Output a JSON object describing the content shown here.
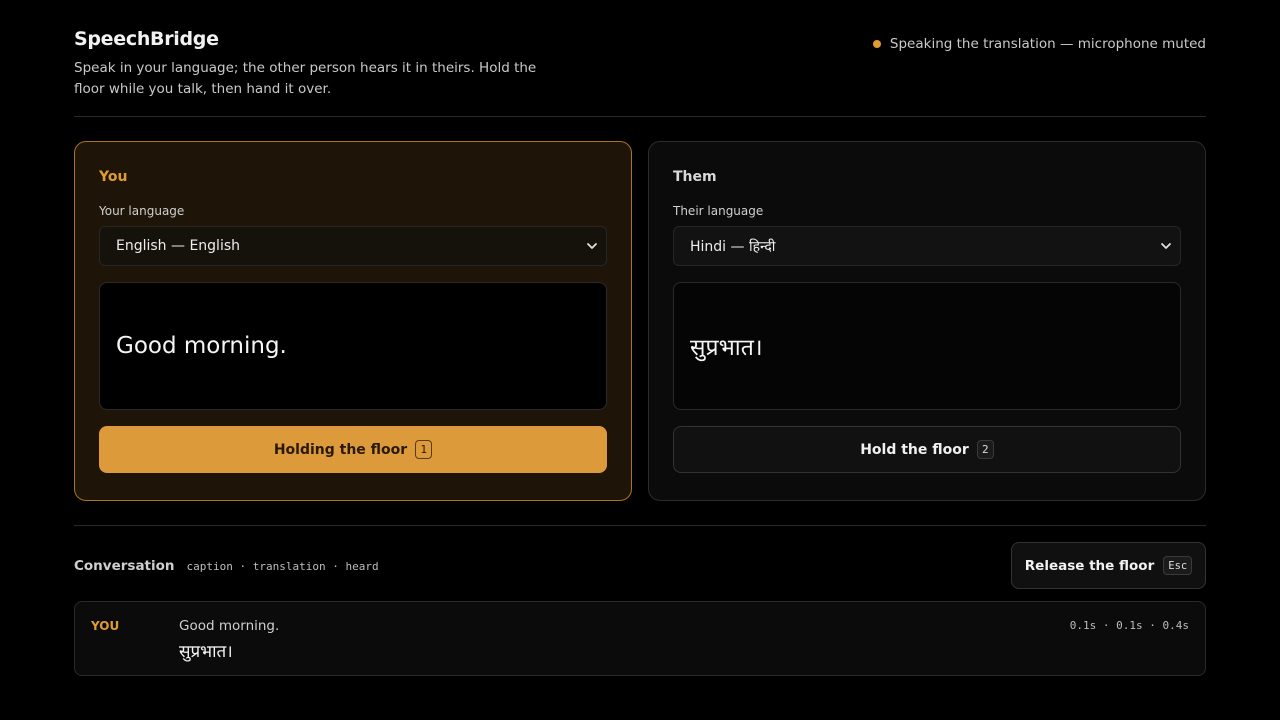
{
  "app": {
    "title": "SpeechBridge",
    "subtitle": "Speak in your language; the other person hears it in theirs. Hold the floor while you talk, then hand it over.",
    "status": "Speaking the translation — microphone muted",
    "accent_color": "#e09c31"
  },
  "panels": {
    "you": {
      "title": "You",
      "lang_label": "Your language",
      "lang_value": "English — English",
      "text": "Good morning.",
      "button_label": "Holding the floor",
      "button_key": "1"
    },
    "them": {
      "title": "Them",
      "lang_label": "Their language",
      "lang_value": "Hindi — हिन्दी",
      "text": "सुप्रभात।",
      "button_label": "Hold the floor",
      "button_key": "2"
    }
  },
  "conversation": {
    "title": "Conversation",
    "legend": "caption · translation · heard",
    "release_label": "Release the floor",
    "release_key": "Esc",
    "entries": [
      {
        "speaker": "YOU",
        "caption": "Good morning.",
        "translation": "सुप्रभात।",
        "timings": "0.1s · 0.1s · 0.4s"
      }
    ]
  },
  "icons": {
    "status": "status-dot-icon",
    "select": "chevron-down-icon"
  }
}
